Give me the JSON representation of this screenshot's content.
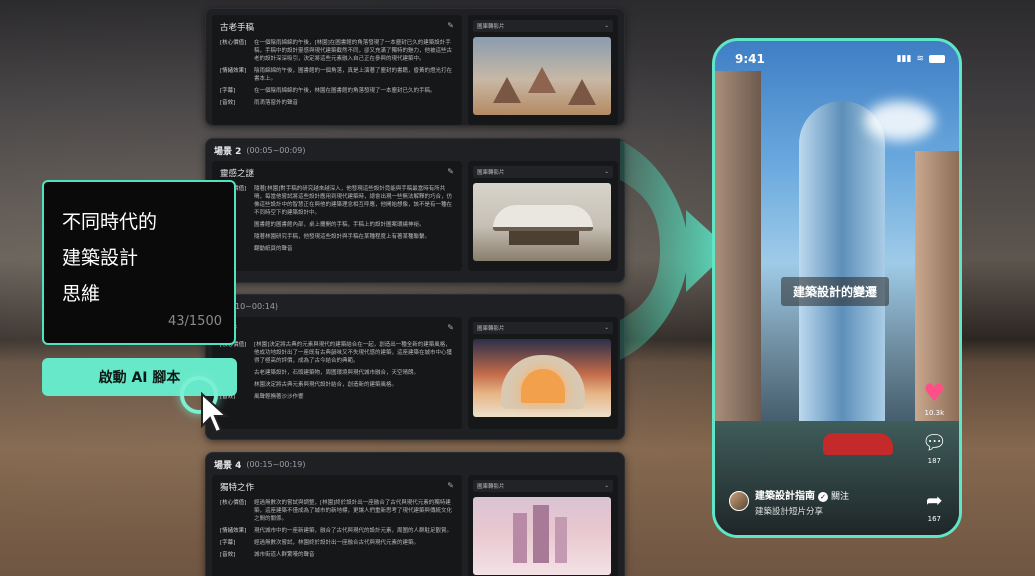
{
  "scenes": [
    {
      "label": "",
      "time": "",
      "title": "古老手稿",
      "rows": [
        {
          "label": "[核心價值]",
          "text": "在一個陰雨綿綿的午後，[林園]在圖書館的角落發現了一本塵封已久的建築設計手稿，手稿中的設計靈感與現代建築截然不同，卻又充滿了獨特的魅力，他被這些古老的設計深深吸引，決定將這些元素融入自己正在參與的現代建築中。"
        },
        {
          "label": "[情緒效果]",
          "text": "陰雨綿綿的午後，圖書館的一個角落，真是上演著了塵封的書籍，昏黃的燈光打在書本上。"
        },
        {
          "label": "[字幕]",
          "text": "在一個陰雨綿綿的午後，林園在圖書館的角落發現了一本塵封已久的手稿。"
        },
        {
          "label": "[音效]",
          "text": "雨滴落窗外的聲音"
        }
      ],
      "media_select": "圖庫轉影片"
    },
    {
      "label": "場景 2",
      "time": "(00:05~00:09)",
      "title": "靈感之謎",
      "rows": [
        {
          "label": "[核心價值]",
          "text": "隨著[林園]對手稿的研究越來越深入，他發現這些設計竟能與手稿最當時有所共鳴，每當他嘗試將這些設計應用到現代建築時，總會出現一些無法解釋的巧合，仿佛這些設計中的智慧正在與他的建築理念相互呼應，他開始想像，該不是有一種在不同時空下的建築設計中。"
        },
        {
          "label": "",
          "text": "圖書館的圖書館內部，桌上攤開的手稿，手稿上的設計圖案環繞神祕。"
        },
        {
          "label": "",
          "text": "隨著林園研究手稿，他發現這些設計與手稿在某種程度上有著某種聯繫。"
        },
        {
          "label": "",
          "text": "翻動紙頁的聲音"
        }
      ],
      "media_select": "圖庫轉影片"
    },
    {
      "label": "",
      "time": "(00:10~00:14)",
      "title": "平衡",
      "rows": [
        {
          "label": "[核心價值]",
          "text": "[林園]決定將古典的元素與現代的建築結合在一起，創造出一種全新的建築風格，他成功地設計出了一座既有古典韻味又不失現代感的建築，這座建築在城市中心獲得了極高的評價，成為了古今結合的典範。"
        },
        {
          "label": "",
          "text": "古老建築設計，石頭建築物，周圍環境與現代城市融合，天空晴朗。"
        },
        {
          "label": "",
          "text": "林園決定將古典元素與現代設計結合，創造新的建築風格。"
        },
        {
          "label": "[音效]",
          "text": "風聲輕撫著沙沙作響"
        }
      ],
      "media_select": "圖庫轉影片"
    },
    {
      "label": "場景 4",
      "time": "(00:15~00:19)",
      "title": "獨特之作",
      "rows": [
        {
          "label": "[核心價值]",
          "text": "經過無數次的嘗試與調整，[林園]終於設計出一座融合了古代與現代元素的獨特建築，這座建築不僅成為了城市的新地標，更讓人們重新思考了現代建築與傳統文化之間的關係。"
        },
        {
          "label": "[情緒效果]",
          "text": "現代城市中的一座新建築，融合了古代與現代的設計元素，周圍的人群駐足觀賞。"
        },
        {
          "label": "[字幕]",
          "text": "經過無數次嘗試，林園終於設計出一座融合古代與現代元素的建築。"
        },
        {
          "label": "[音效]",
          "text": "城市街道人群驚嘆的聲音"
        }
      ],
      "media_select": "圖庫轉影片"
    }
  ],
  "input": {
    "text": "不同時代的\n建築設計\n思維",
    "counter": "43/1500"
  },
  "start_button": "啟動 AI 腳本",
  "phone": {
    "time": "9:41",
    "caption": "建築設計的變遷",
    "likes": "10.3k",
    "comments": "187",
    "shares": "167",
    "profile_name": "建築設計指南",
    "follow": "關注",
    "profile_sub": "建築設計短片分享"
  },
  "colors": {
    "accent": "#5ee6c6",
    "button": "#67e8c9",
    "heart": "#ff4f86"
  }
}
